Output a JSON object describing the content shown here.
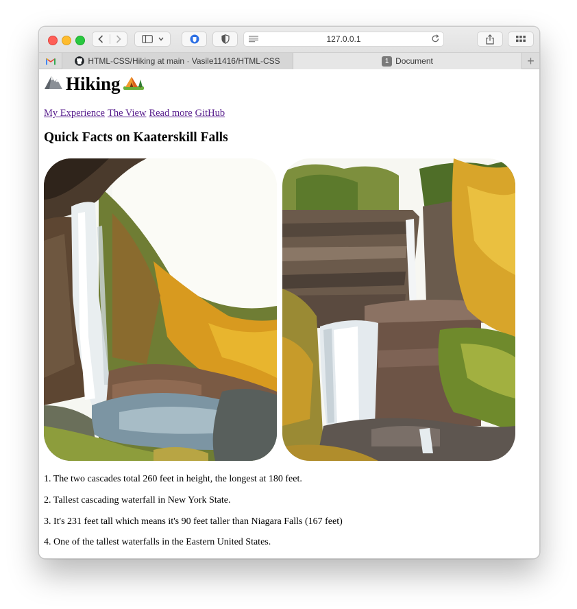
{
  "browser": {
    "address": "127.0.0.1",
    "tabs": [
      {
        "label": ""
      },
      {
        "label": "HTML-CSS/Hiking at main · Vasile11416/HTML-CSS"
      },
      {
        "label": "Document",
        "badge": "1"
      }
    ],
    "new_tab": "+"
  },
  "page": {
    "title": "Hiking",
    "title_emoji_left": "🏔",
    "title_emoji_right": "🏕",
    "nav": [
      "My Experience",
      "The View",
      "Read more",
      "GitHub"
    ],
    "subtitle": "Quick Facts on Kaaterskill Falls",
    "facts": [
      "1. The two cascades total 260 feet in height, the longest at 180 feet.",
      "2. Tallest cascading waterfall in New York State.",
      "3. It's 231 feet tall which means it's 90 feet taller than Niagara Falls (167 feet)",
      "4. One of the tallest waterfalls in the Eastern United States."
    ]
  },
  "colors": {
    "link": "#551a8b",
    "traffic_red": "#fe5f57",
    "traffic_yellow": "#febc2e",
    "traffic_green": "#28c840"
  }
}
